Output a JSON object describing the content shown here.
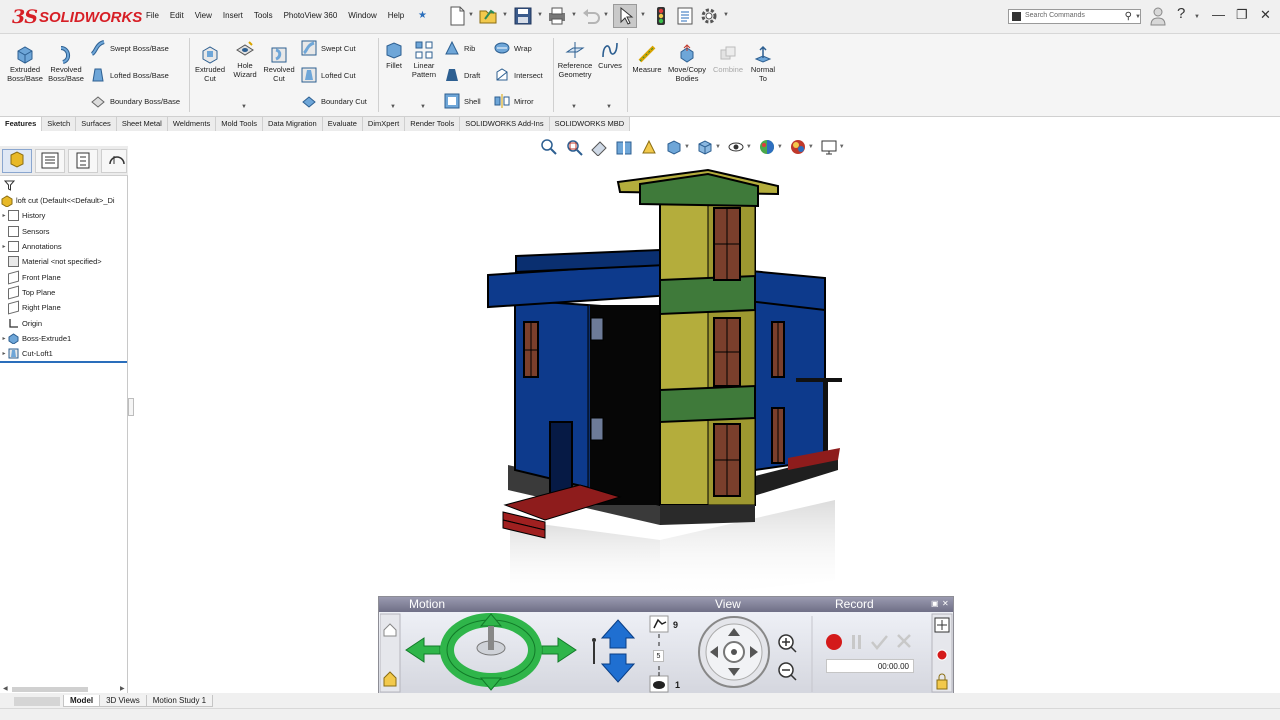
{
  "app": {
    "logo_prefix": "3S",
    "logo_text": "SOLIDWORKS"
  },
  "menu": [
    "File",
    "Edit",
    "View",
    "Insert",
    "Tools",
    "PhotoView 360",
    "Window",
    "Help"
  ],
  "search": {
    "placeholder": "Search Commands"
  },
  "ribbon": {
    "extruded_boss": "Extruded Boss/Base",
    "revolved_boss": "Revolved Boss/Base",
    "swept_boss": "Swept Boss/Base",
    "lofted_boss": "Lofted Boss/Base",
    "boundary_boss": "Boundary Boss/Base",
    "extruded_cut": "Extruded Cut",
    "hole_wizard": "Hole Wizard",
    "revolved_cut": "Revolved Cut",
    "swept_cut": "Swept Cut",
    "lofted_cut": "Lofted Cut",
    "boundary_cut": "Boundary Cut",
    "fillet": "Fillet",
    "linear_pattern": "Linear Pattern",
    "rib": "Rib",
    "draft": "Draft",
    "shell": "Shell",
    "wrap": "Wrap",
    "intersect": "Intersect",
    "mirror": "Mirror",
    "reference_geometry": "Reference Geometry",
    "curves": "Curves",
    "measure": "Measure",
    "move_copy": "Move/Copy Bodies",
    "combine": "Combine",
    "normal_to": "Normal To"
  },
  "command_tabs": [
    "Features",
    "Sketch",
    "Surfaces",
    "Sheet Metal",
    "Weldments",
    "Mold Tools",
    "Data Migration",
    "Evaluate",
    "DimXpert",
    "Render Tools",
    "SOLIDWORKS Add-Ins",
    "SOLIDWORKS MBD"
  ],
  "feature_tree": {
    "root": "loft cut  (Default<<Default>_Di",
    "items": [
      {
        "label": "History",
        "expandable": true
      },
      {
        "label": "Sensors",
        "expandable": false
      },
      {
        "label": "Annotations",
        "expandable": true
      },
      {
        "label": "Material <not specified>",
        "expandable": false
      },
      {
        "label": "Front Plane",
        "expandable": false
      },
      {
        "label": "Top Plane",
        "expandable": false
      },
      {
        "label": "Right Plane",
        "expandable": false
      },
      {
        "label": "Origin",
        "expandable": false
      },
      {
        "label": "Boss-Extrude1",
        "expandable": true
      },
      {
        "label": "Cut-Loft1",
        "expandable": true
      }
    ]
  },
  "motion_panel": {
    "motion_label": "Motion",
    "view_label": "View",
    "record_label": "Record",
    "speed_fast": "9",
    "speed_current": "5",
    "speed_slow": "1",
    "time": "00:00.00"
  },
  "bottom_tabs": [
    "Model",
    "3D Views",
    "Motion Study 1"
  ],
  "colors": {
    "brand_red": "#d71f26",
    "walls_blue": "#0d3a8c",
    "tower_yellow": "#b4ad3c",
    "band_green": "#3f7a3a",
    "steps_red": "#8e1c1c",
    "window_brown": "#7a3f2c"
  }
}
